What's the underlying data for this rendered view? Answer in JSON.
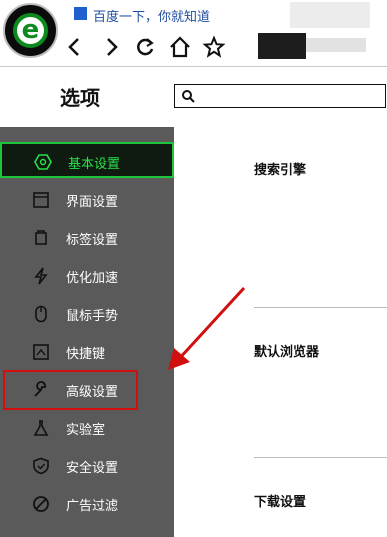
{
  "browser": {
    "tab_title": "百度一下，你就知道",
    "nav_icons": [
      "back-icon",
      "forward-icon",
      "refresh-icon",
      "home-icon",
      "star-icon"
    ]
  },
  "options": {
    "title": "选项",
    "search_placeholder": ""
  },
  "sidebar": {
    "items": [
      {
        "label": "基本设置",
        "icon": "hexagon-icon",
        "active": true
      },
      {
        "label": "界面设置",
        "icon": "window-icon"
      },
      {
        "label": "标签设置",
        "icon": "tab-icon"
      },
      {
        "label": "优化加速",
        "icon": "lightning-icon"
      },
      {
        "label": "鼠标手势",
        "icon": "mouse-icon"
      },
      {
        "label": "快捷键",
        "icon": "keyboard-icon"
      },
      {
        "label": "高级设置",
        "icon": "wrench-icon",
        "highlighted": true
      },
      {
        "label": "实验室",
        "icon": "flask-icon"
      },
      {
        "label": "安全设置",
        "icon": "shield-icon"
      },
      {
        "label": "广告过滤",
        "icon": "block-icon"
      }
    ]
  },
  "main": {
    "sections": [
      {
        "title": "搜索引擎"
      },
      {
        "title": "默认浏览器"
      },
      {
        "title": "下载设置"
      }
    ]
  },
  "colors": {
    "accent_green": "#29e04a",
    "sidebar_bg": "#5a5a5a",
    "annotation_red": "#d10f0f"
  }
}
